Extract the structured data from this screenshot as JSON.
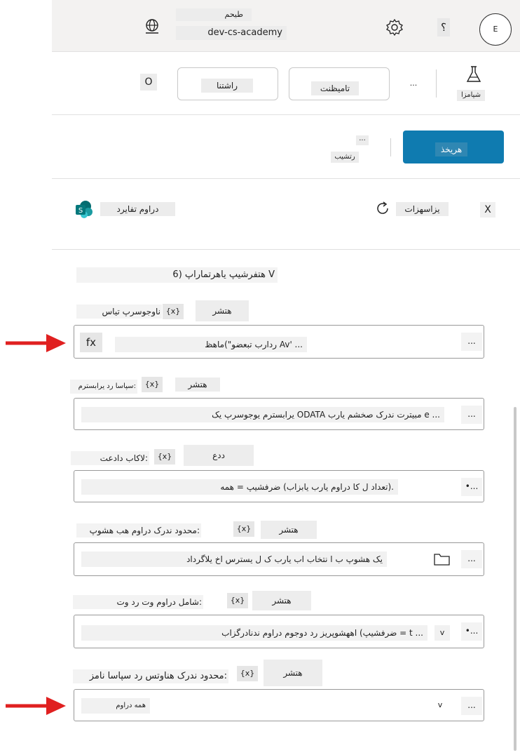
{
  "header": {
    "env_label": "طیحم",
    "env_name": "dev-cs-academy",
    "help": "؟",
    "avatar": "E"
  },
  "toolbar": {
    "flask_label": "شیامزا",
    "ellipsis": "...",
    "btn1": "تامیظنت",
    "btn2": "راشتنا",
    "icon_char": "O"
  },
  "toolbar2": {
    "test": "هریخذ",
    "more_dots": "...",
    "more_label": "رتشیب"
  },
  "connection": {
    "close": "X",
    "refresh": "یزاسهزات",
    "sharepoint": "دراوم تفایرد"
  },
  "section_title": "هتفرشیپ یاهرتماراپ (6 V",
  "params": [
    {
      "label": "ناوجوسرپ تیاس",
      "fx": "{x}",
      "kind": "هتشر",
      "value": "ردارب تبعضو\")ماهظ Av' ... ",
      "more": "..."
    },
    {
      "label": "سپاسا رد یرابسترم:",
      "fx": "{x}",
      "kind": "هتشر",
      "value": "یرابسترم یوجوسرپ یک ODATA مبیترت ندرک صخشم یارب e ...",
      "more": "..."
    },
    {
      "label": "لاکاب دادعت:",
      "fx": "{x}",
      "kind": "ددع",
      "value": "تعداد ل کا دراوم یارب یابزاب) ضرفشیپ = همه).",
      "more": "•..."
    },
    {
      "label": "محدود ندرک دراوم هب هشوپ:",
      "fx": "{x}",
      "kind": "هتشر",
      "value": "یک هشوپ ب ا نتخاب اب یارب ک ل یسترس اخ یلاگرداد",
      "more": "..."
    },
    {
      "label": "شامل دراوم وت رد وت:",
      "fx": "{x}",
      "kind": "هتشر",
      "value": "ضرفشیپ) اههشوپریز رد دوجوم دراوم ندنادرگزاب = t ...",
      "chevron": "v",
      "more": "•..."
    },
    {
      "label": "محدود ندرک هناوتس رد سپاسا نامز:",
      "fx": "{x}",
      "kind": "هتشر",
      "value": "همه دراوم",
      "chevron": "v",
      "more": "..."
    }
  ],
  "colors": {
    "accent": "#0f7bb0",
    "arrow": "#e02020",
    "sharepoint": "#0a8f8f"
  }
}
